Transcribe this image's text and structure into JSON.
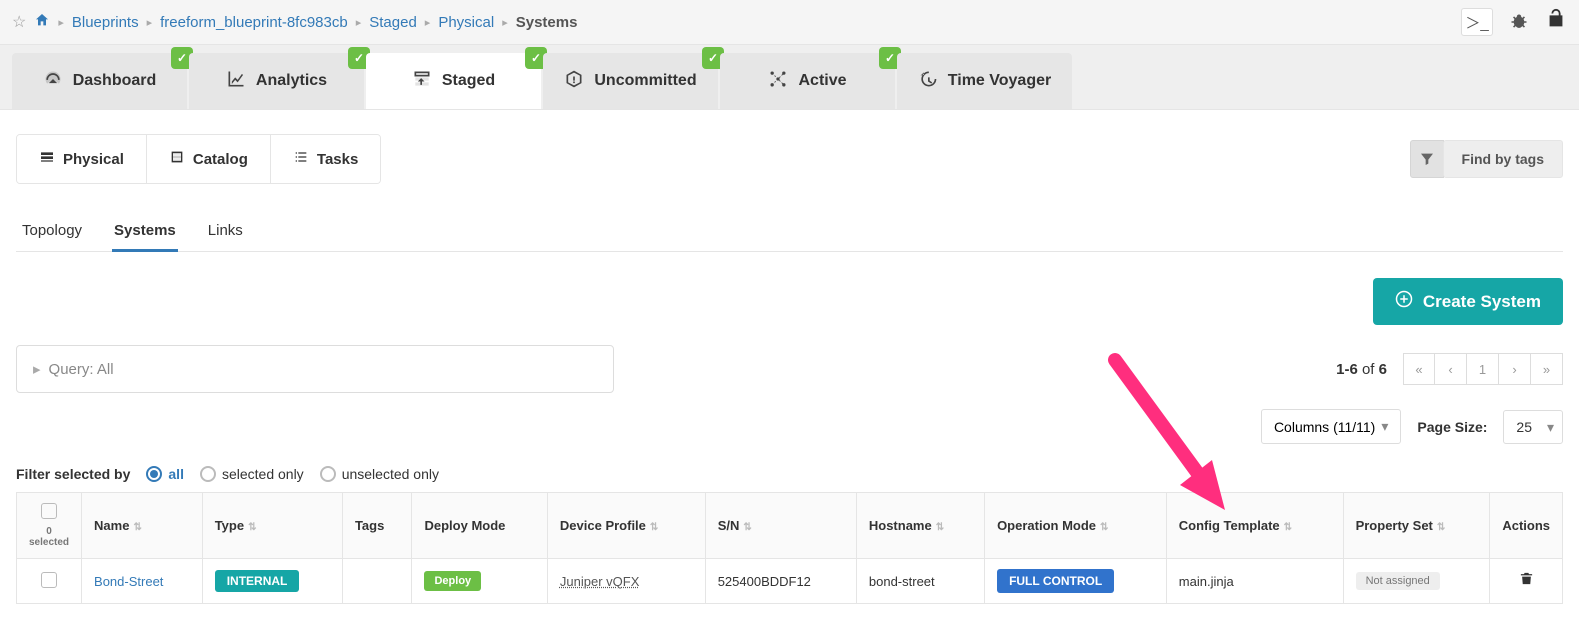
{
  "breadcrumb": {
    "blueprints": "Blueprints",
    "blueprint_name": "freeform_blueprint-8fc983cb",
    "staged": "Staged",
    "physical": "Physical",
    "current": "Systems"
  },
  "mainTabs": {
    "dashboard": "Dashboard",
    "analytics": "Analytics",
    "staged": "Staged",
    "uncommitted": "Uncommitted",
    "active": "Active",
    "timevoyager": "Time Voyager"
  },
  "subTabs": {
    "physical": "Physical",
    "catalog": "Catalog",
    "tasks": "Tasks"
  },
  "findByTags": "Find by tags",
  "tertiaryTabs": {
    "topology": "Topology",
    "systems": "Systems",
    "links": "Links"
  },
  "createSystem": "Create System",
  "query": {
    "label": "Query: All"
  },
  "pagination": {
    "range": "1-6",
    "of": "of",
    "total": "6",
    "page": "1"
  },
  "columnsBtn": "Columns (11/11)",
  "pageSizeLabel": "Page Size:",
  "pageSizeValue": "25",
  "filter": {
    "label": "Filter selected by",
    "all": "all",
    "selected": "selected only",
    "unselected": "unselected only"
  },
  "columns": {
    "selectedCount": "0 selected",
    "name": "Name",
    "type": "Type",
    "tags": "Tags",
    "deployMode": "Deploy Mode",
    "deviceProfile": "Device Profile",
    "sn": "S/N",
    "hostname": "Hostname",
    "operationMode": "Operation Mode",
    "configTemplate": "Config Template",
    "propertySet": "Property Set",
    "actions": "Actions"
  },
  "rows": [
    {
      "name": "Bond-Street",
      "type": "INTERNAL",
      "tags": "",
      "deployMode": "Deploy",
      "deviceProfile": "Juniper vQFX",
      "sn": "525400BDDF12",
      "hostname": "bond-street",
      "operationMode": "FULL CONTROL",
      "configTemplate": "main.jinja",
      "propertySet": "Not assigned"
    }
  ]
}
